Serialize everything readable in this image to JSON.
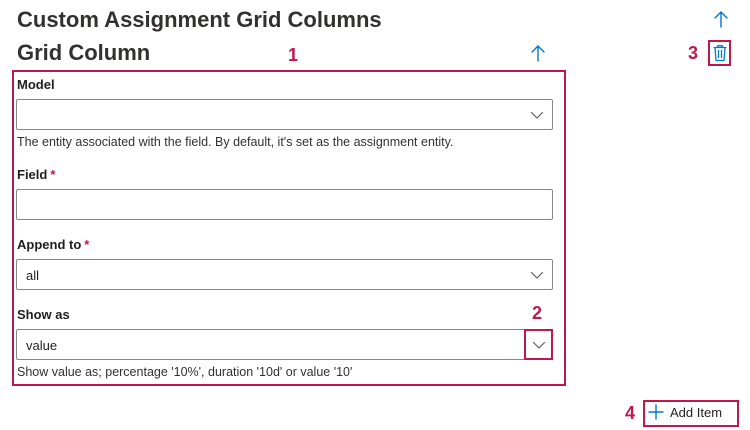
{
  "header": {
    "title": "Custom Assignment Grid Columns",
    "subtitle": "Grid Column"
  },
  "callouts": [
    "1",
    "2",
    "3",
    "4"
  ],
  "form": {
    "model": {
      "label": "Model",
      "value": "",
      "help": "The entity associated with the field. By default, it's set as the assignment entity."
    },
    "field": {
      "label": "Field",
      "required_mark": "*",
      "value": ""
    },
    "append_to": {
      "label": "Append to",
      "required_mark": "*",
      "value": "all"
    },
    "show_as": {
      "label": "Show as",
      "value": "value",
      "help": "Show value as; percentage '10%', duration '10d' or value '10'"
    }
  },
  "actions": {
    "add_item_label": "Add Item"
  },
  "icons": {
    "move_up_outer": "arrow-up-icon",
    "move_up_inner": "arrow-up-icon",
    "delete": "trash-icon",
    "dropdown": "chevron-down-icon",
    "add": "plus-icon"
  },
  "colors": {
    "accent": "#0078d4",
    "callout": "#c0174c",
    "border": "#8a8886",
    "text": "#201f1e"
  }
}
